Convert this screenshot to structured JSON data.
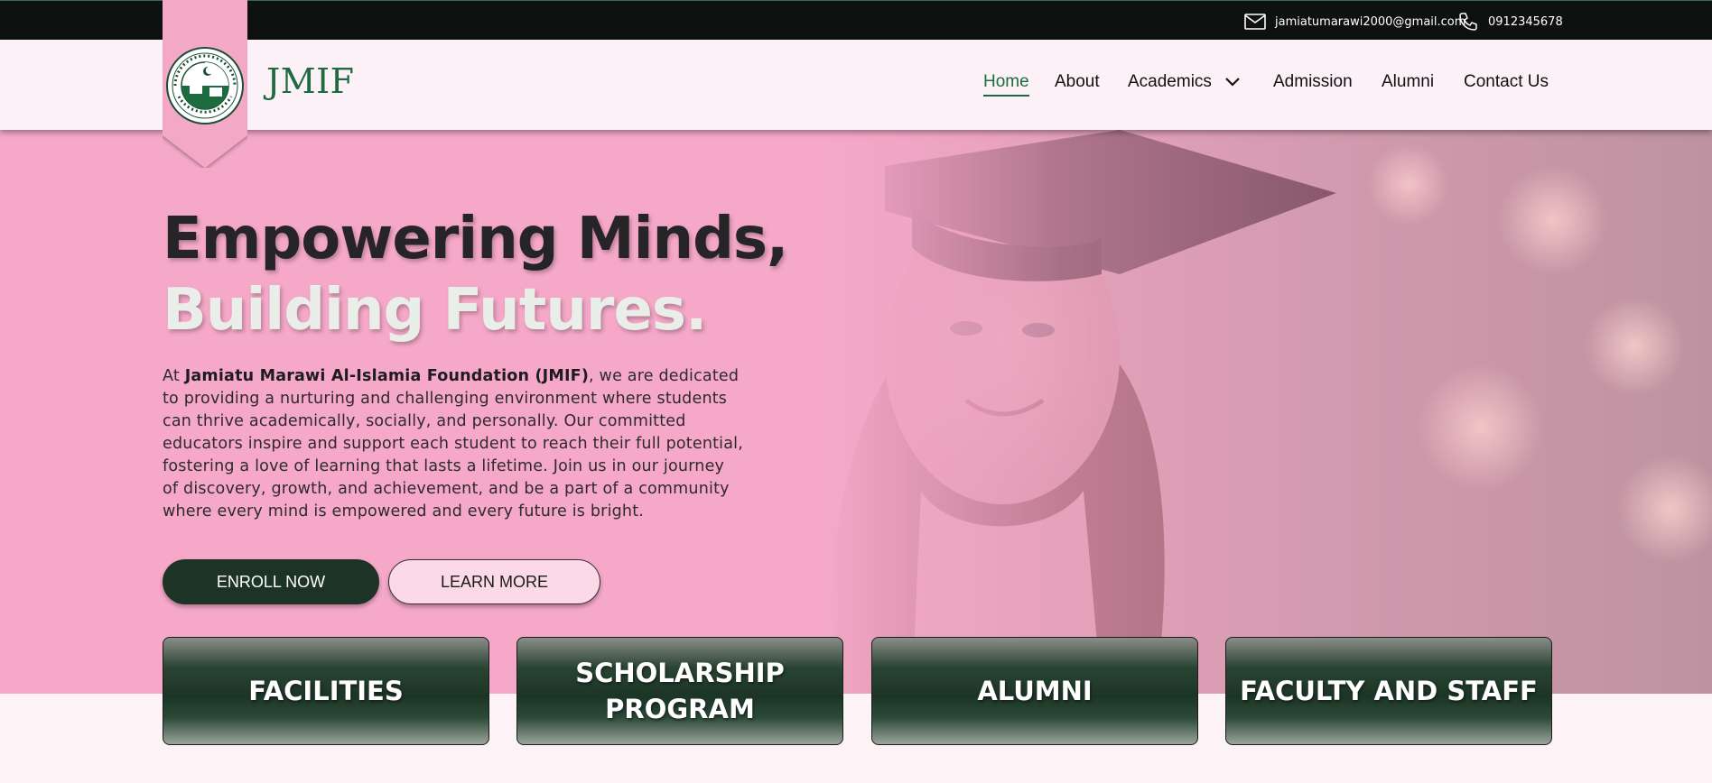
{
  "topbar": {
    "email": "jamiatumarawi2000@gmail.com",
    "phone": "0912345678",
    "icons": [
      "mail-icon",
      "phone-icon"
    ]
  },
  "header": {
    "brand": "JMIF",
    "logo": "school-seal-logo",
    "nav": [
      {
        "label": "Home",
        "active": true
      },
      {
        "label": "About"
      },
      {
        "label": "Academics",
        "has_dropdown": true
      },
      {
        "label": "Admission"
      },
      {
        "label": "Alumni"
      },
      {
        "label": "Contact Us"
      }
    ]
  },
  "hero": {
    "headline_line1": "Empowering Minds,",
    "headline_line2": "Building Futures.",
    "intro_prefix": "At ",
    "intro_bold": "Jamiatu Marawi Al-Islamia Foundation (JMIF)",
    "intro_rest": ", we are dedicated to providing a nurturing and challenging environment where students can thrive academically, socially, and personally. Our committed educators inspire and support each student to reach their full potential, fostering a love of learning that lasts a lifetime. Join us in our journey of discovery, growth, and achievement, and be a part of a community where every mind is empowered and every future is bright.",
    "enroll_label": "ENROLL NOW",
    "learn_label": "LEARN MORE"
  },
  "cards": [
    {
      "line1": "FACILITIES",
      "line2": ""
    },
    {
      "line1": "SCHOLARSHIP",
      "line2": "PROGRAM"
    },
    {
      "line1": "ALUMNI",
      "line2": ""
    },
    {
      "line1": "FACULTY AND STAFF",
      "line2": ""
    }
  ],
  "colors": {
    "topbar": "#0f1110",
    "header_bg": "#fdf1f8",
    "hero_pink": "#f5a8c8",
    "brand_green": "#1d6b3f",
    "dark_green": "#1d3325"
  }
}
